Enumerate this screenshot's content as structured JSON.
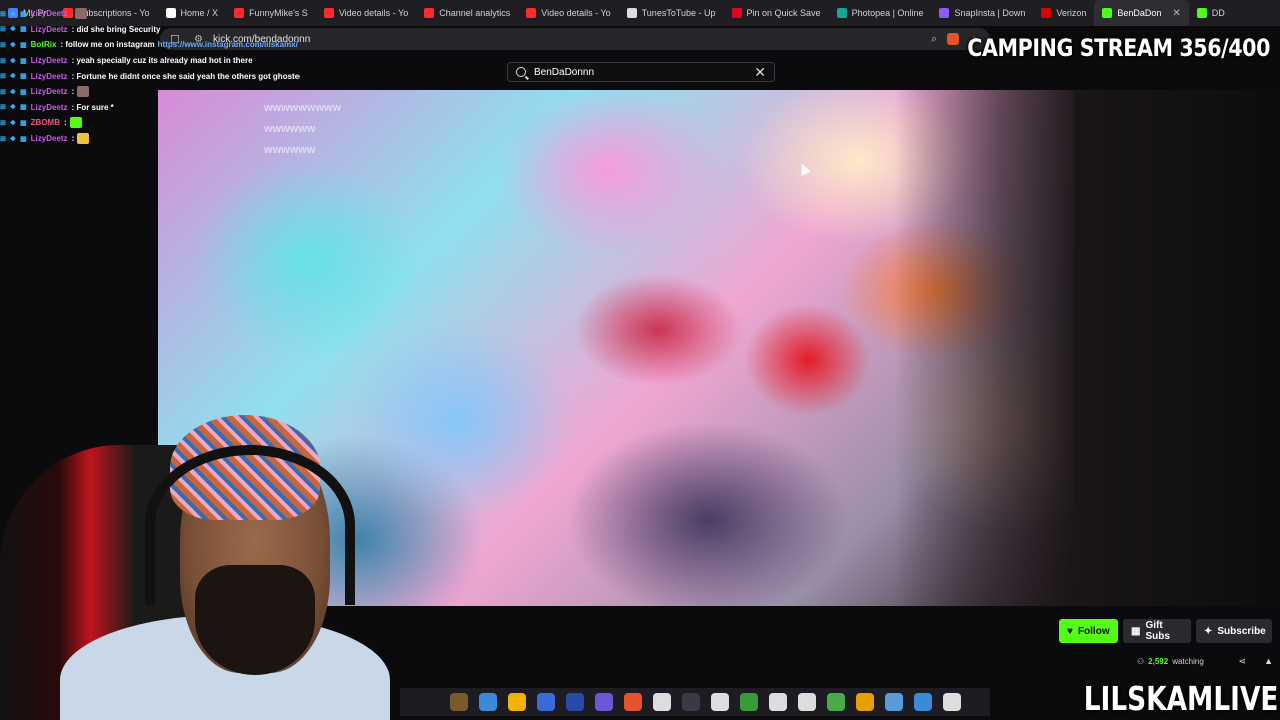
{
  "browser": {
    "tabs": [
      {
        "label": "My Pr",
        "fav": "#4a7dff",
        "active": false
      },
      {
        "label": "Subscriptions - Yo",
        "fav": "#ff2a2a",
        "active": false
      },
      {
        "label": "Home / X",
        "fav": "#ffffff",
        "active": false
      },
      {
        "label": "FunnyMike's S",
        "fav": "#ff2a2a",
        "active": false
      },
      {
        "label": "Video details - Yo",
        "fav": "#ff2a2a",
        "active": false
      },
      {
        "label": "Channel analytics",
        "fav": "#ff2a2a",
        "active": false
      },
      {
        "label": "Video details - Yo",
        "fav": "#ff2a2a",
        "active": false
      },
      {
        "label": "TunesToTube - Up",
        "fav": "#dddddd",
        "active": false
      },
      {
        "label": "Pin on Quick Save",
        "fav": "#e60023",
        "active": false
      },
      {
        "label": "Photopea | Online",
        "fav": "#18a497",
        "active": false
      },
      {
        "label": "SnapInsta | Down",
        "fav": "#8a5cf6",
        "active": false
      },
      {
        "label": "Verizon",
        "fav": "#e00000",
        "active": false
      },
      {
        "label": "BenDaDon",
        "fav": "#53fc18",
        "active": true
      },
      {
        "label": "DD",
        "fav": "#53fc18",
        "active": false
      }
    ],
    "url": "kick.com/bendadonnn"
  },
  "overlay": {
    "title": "CAMPING STREAM 356/400",
    "name": "LILSKAMLIVE"
  },
  "chat": [
    {
      "user": "LizyDeetz",
      "user_color": "#c85ae8",
      "msg": "",
      "emote": "#8a6a6a"
    },
    {
      "user": "LizyDeetz",
      "user_color": "#c85ae8",
      "msg": ": did she bring Security",
      "link": "",
      "emote": ""
    },
    {
      "user": "BotRix",
      "user_color": "#53fc18",
      "msg": ": follow me on instagram",
      "link": "https://www.instagram.com/lilskamx/",
      "emote": ""
    },
    {
      "user": "LizyDeetz",
      "user_color": "#c85ae8",
      "msg": ": yeah specially cuz its already mad hot in there",
      "link": "",
      "emote": ""
    },
    {
      "user": "LizyDeetz",
      "user_color": "#c85ae8",
      "msg": ": Fortune he didnt once she said yeah the others got ghosted",
      "link": "",
      "emote": ""
    },
    {
      "user": "LizyDeetz",
      "user_color": "#c85ae8",
      "msg": ":",
      "link": "",
      "emote": "#8a6a6a"
    },
    {
      "user": "LizyDeetz",
      "user_color": "#c85ae8",
      "msg": ": For sure *",
      "link": "",
      "emote": ""
    },
    {
      "user": "ZBOMB",
      "user_color": "#e85a7a",
      "msg": ":",
      "link": "",
      "emote": "#53fc18"
    },
    {
      "user": "LizyDeetz",
      "user_color": "#c85ae8",
      "msg": ":",
      "link": "",
      "emote": "#f0c040"
    }
  ],
  "search": {
    "value": "BenDaDonnn"
  },
  "video_chat": [
    "wwwwwwwww",
    "wwwwww",
    "",
    "wwwwww"
  ],
  "actions": {
    "follow": "Follow",
    "gift": "Gift Subs",
    "subscribe": "Subscribe"
  },
  "stats": {
    "viewers": "2,592",
    "watching": "watching"
  },
  "taskbar_icons": [
    "#7a5a2a",
    "#3a8ad6",
    "#f0b400",
    "#3a6ad6",
    "#2a4aa8",
    "#6a5ad6",
    "#e5532c",
    "#dddddd",
    "#3a3a46",
    "#dddddd",
    "#3a9a3a",
    "#dddddd",
    "#dddddd",
    "#4aaa4a",
    "#e5a000",
    "#5a9ad6",
    "#3a8ad6",
    "#dddddd"
  ]
}
